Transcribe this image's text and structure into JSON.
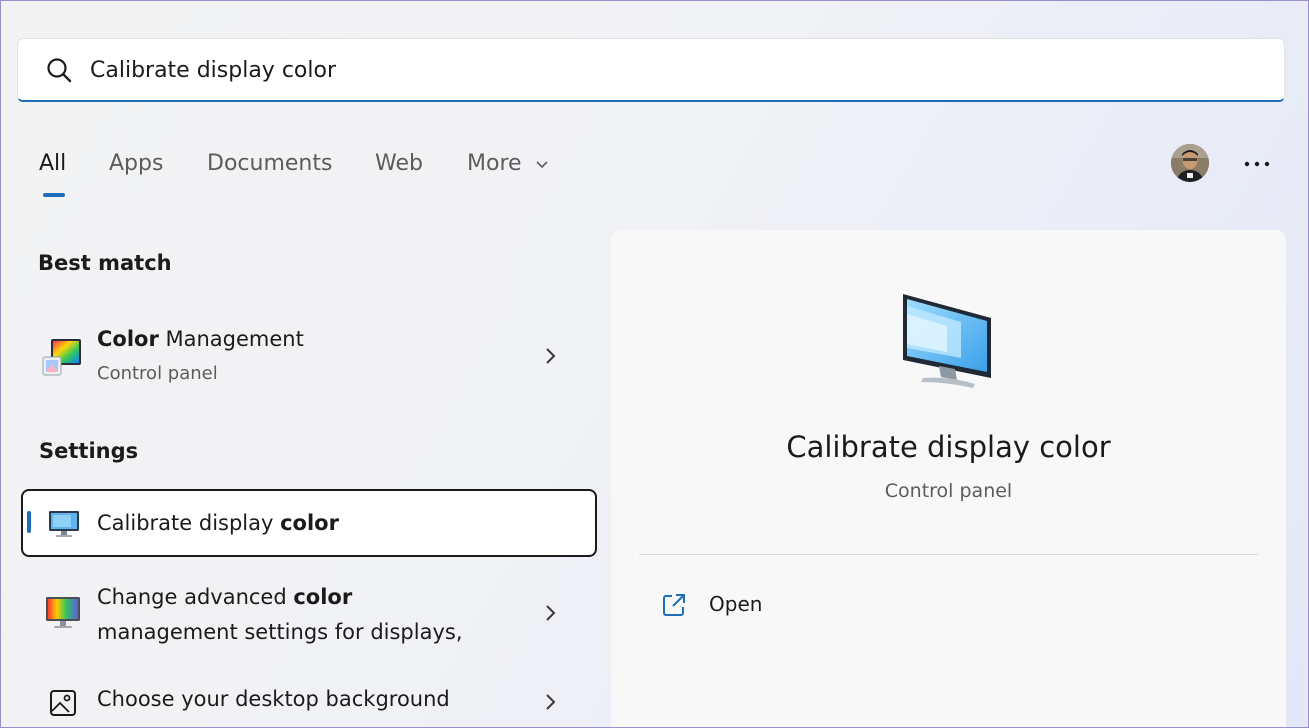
{
  "search": {
    "value": "Calibrate display color",
    "icon": "search-icon"
  },
  "tabs": [
    {
      "label": "All",
      "active": true
    },
    {
      "label": "Apps"
    },
    {
      "label": "Documents"
    },
    {
      "label": "Web"
    },
    {
      "label": "More"
    }
  ],
  "sections": {
    "best_match": "Best match",
    "settings": "Settings"
  },
  "best_match": {
    "title_bold": "Color",
    "title_rest": " Management",
    "subtitle": "Control panel"
  },
  "settings_items": [
    {
      "title_plain": "Calibrate display ",
      "title_bold": "color"
    },
    {
      "line1_plain": "Change advanced ",
      "line1_bold": "color",
      "line2": "management settings for displays,"
    },
    {
      "title": "Choose your desktop background"
    }
  ],
  "detail": {
    "title": "Calibrate display color",
    "subtitle": "Control panel",
    "open_label": "Open"
  },
  "colors": {
    "accent": "#1f6fb8",
    "selection_border": "#1b1b1b"
  }
}
